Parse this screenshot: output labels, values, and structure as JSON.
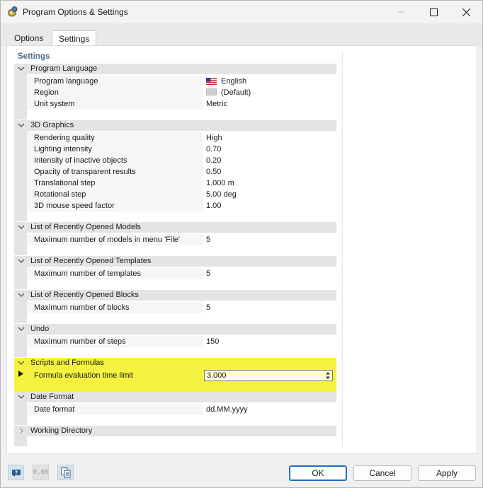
{
  "window": {
    "title": "Program Options & Settings"
  },
  "tabs": [
    {
      "label": "Options"
    },
    {
      "label": "Settings"
    }
  ],
  "settings_header": "Settings",
  "groups": {
    "language": {
      "title": "Program Language",
      "rows": [
        {
          "name": "Program language",
          "value": "English",
          "icon": "us-flag-icon"
        },
        {
          "name": "Region",
          "value": "(Default)",
          "icon": "region-swatch-icon"
        },
        {
          "name": "Unit system",
          "value": "Metric"
        }
      ]
    },
    "graphics": {
      "title": "3D Graphics",
      "rows": [
        {
          "name": "Rendering quality",
          "value": "High"
        },
        {
          "name": "Lighting intensity",
          "value": "0.70"
        },
        {
          "name": "Intensity of inactive objects",
          "value": "0.20"
        },
        {
          "name": "Opacity of transparent results",
          "value": "0.50"
        },
        {
          "name": "Translational step",
          "value": "1.000 m"
        },
        {
          "name": "Rotational step",
          "value": "5.00 deg"
        },
        {
          "name": "3D mouse speed factor",
          "value": "1.00"
        }
      ]
    },
    "models": {
      "title": "List of Recently Opened Models",
      "rows": [
        {
          "name": "Maximum number of models in menu 'File'",
          "value": "5"
        }
      ]
    },
    "templates": {
      "title": "List of Recently Opened Templates",
      "rows": [
        {
          "name": "Maximum number of templates",
          "value": "5"
        }
      ]
    },
    "blocks": {
      "title": "List of Recently Opened Blocks",
      "rows": [
        {
          "name": "Maximum number of blocks",
          "value": "5"
        }
      ]
    },
    "undo": {
      "title": "Undo",
      "rows": [
        {
          "name": "Maximum number of steps",
          "value": "150"
        }
      ]
    },
    "scripts": {
      "title": "Scripts and Formulas",
      "rows": [
        {
          "name": "Formula evaluation time limit",
          "value": "3.000"
        }
      ]
    },
    "date": {
      "title": "Date Format",
      "rows": [
        {
          "name": "Date format",
          "value": "dd.MM.yyyy"
        }
      ]
    },
    "workdir": {
      "title": "Working Directory",
      "collapsed": true
    }
  },
  "buttons": {
    "ok": "OK",
    "cancel": "Cancel",
    "apply": "Apply"
  },
  "toolbar": {
    "help_icon": "help-icon",
    "decimals_label": "0,00",
    "copy_icon": "copy-settings-icon"
  },
  "colors": {
    "highlight": "#f4f23e",
    "settings_header": "#4a6c8c",
    "ok_border": "#1e6fc4"
  }
}
